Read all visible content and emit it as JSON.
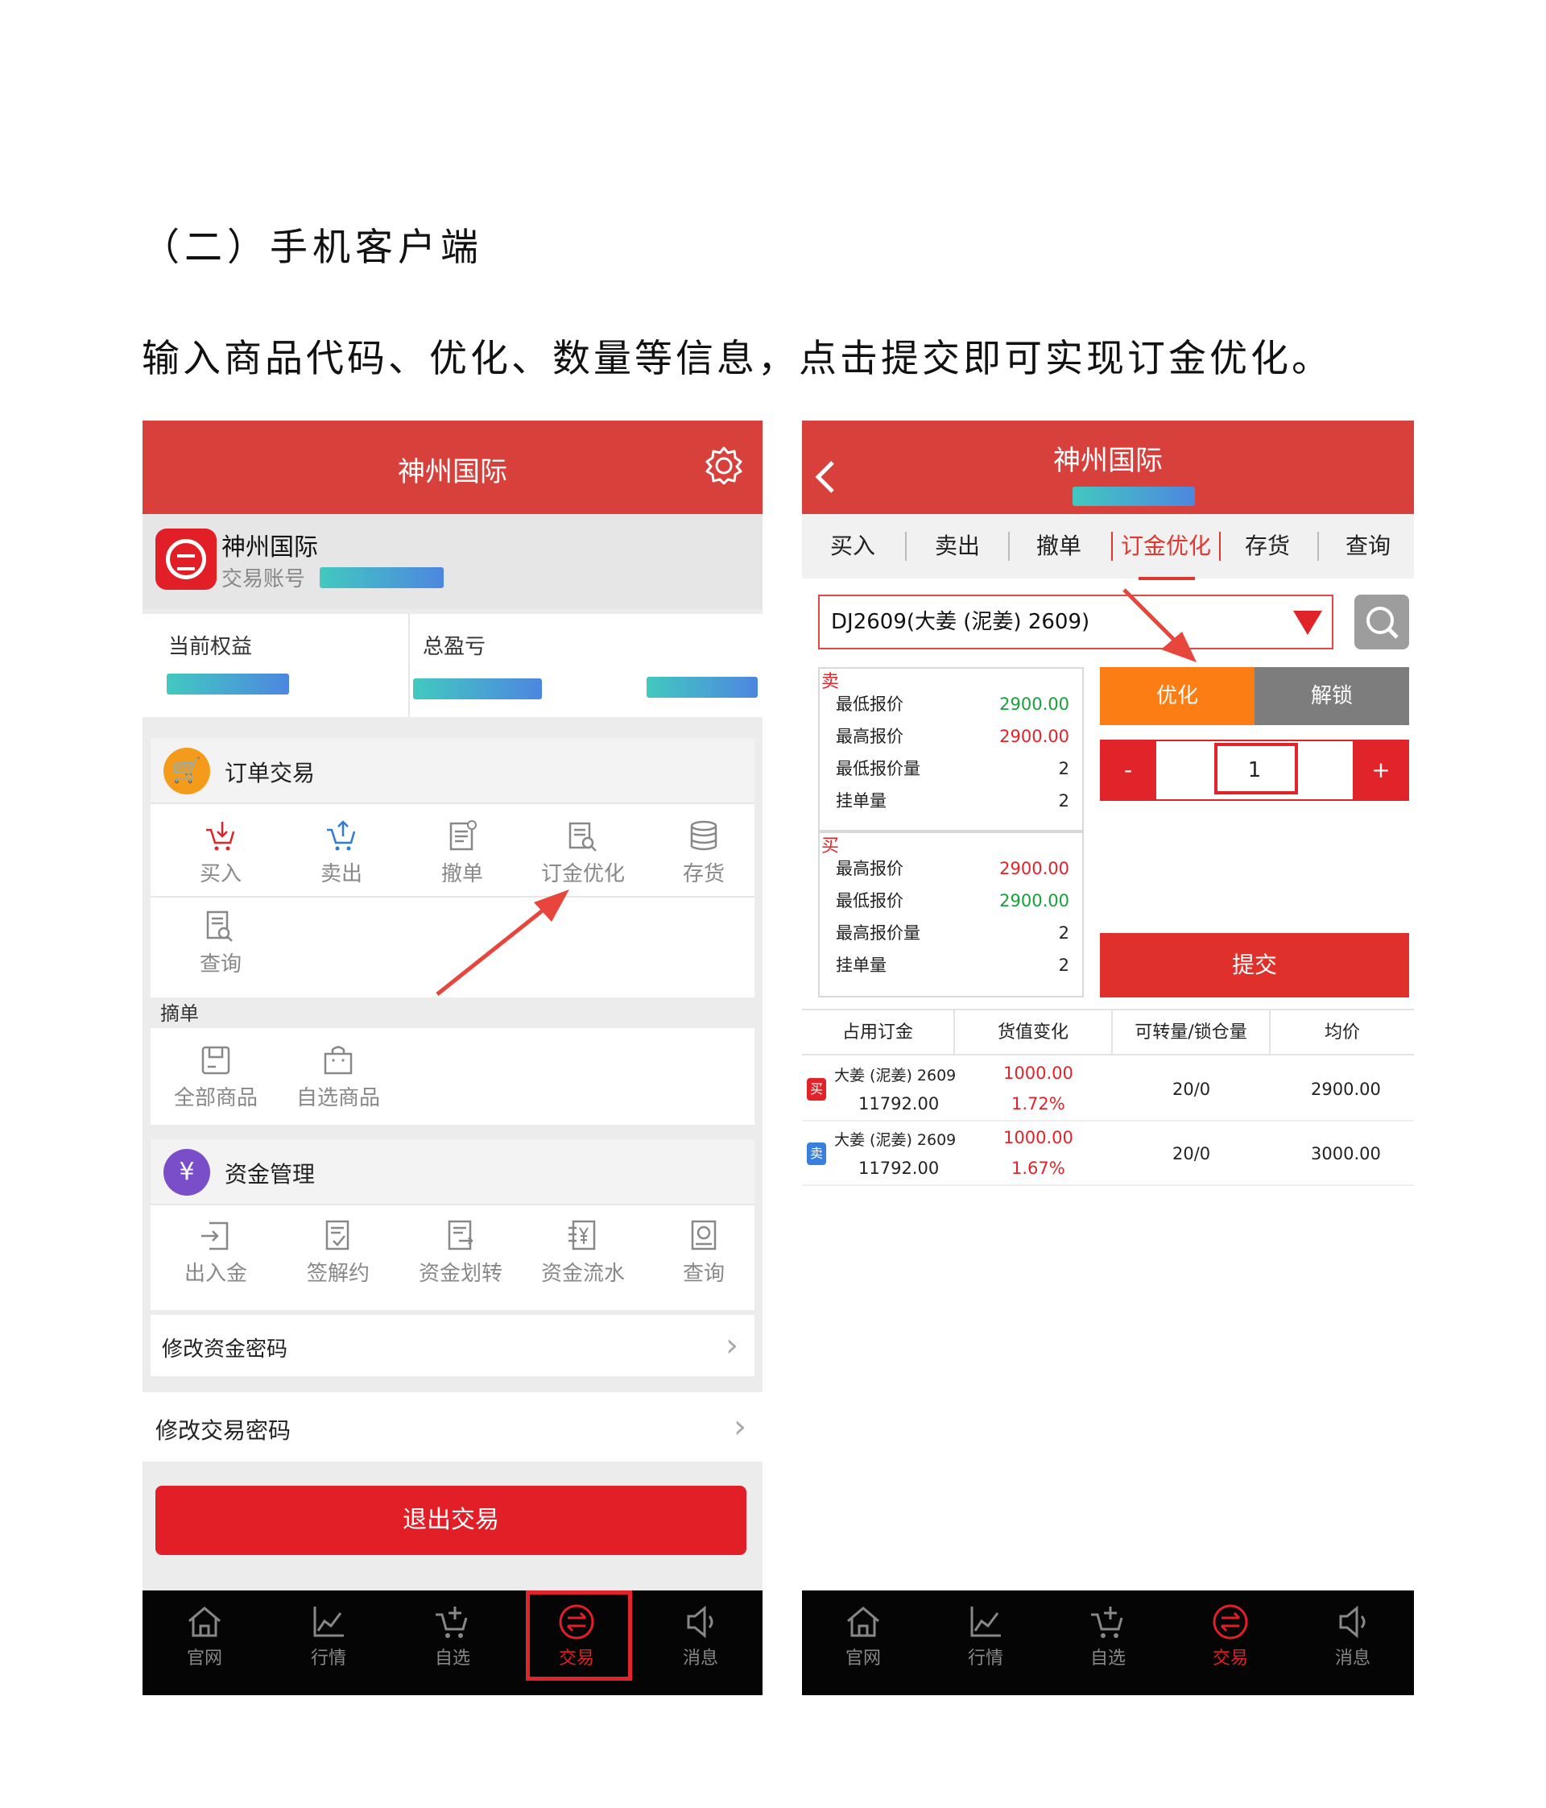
{
  "doc": {
    "section_heading": "（二）手机客户端",
    "intro": "输入商品代码、优化、数量等信息，点击提交即可实现订金优化。"
  },
  "left": {
    "header_title": "神州国际",
    "account_name": "神州国际",
    "account_label": "交易账号",
    "equity_label": "当前权益",
    "pnl_label": "总盈亏",
    "order_section": "订单交易",
    "order_items": [
      "买入",
      "卖出",
      "撤单",
      "订金优化",
      "存货",
      "查询"
    ],
    "pick_label": "摘单",
    "pick_items": [
      "全部商品",
      "自选商品"
    ],
    "fund_section": "资金管理",
    "fund_badge": "¥",
    "fund_items": [
      "出入金",
      "签解约",
      "资金划转",
      "资金流水",
      "查询"
    ],
    "change_fund_pwd": "修改资金密码",
    "change_trade_pwd": "修改交易密码",
    "logout": "退出交易"
  },
  "tabbar": {
    "items": [
      "官网",
      "行情",
      "自选",
      "交易",
      "消息"
    ],
    "active_index": 3
  },
  "right": {
    "header_title": "神州国际",
    "tabs": [
      "买入",
      "卖出",
      "撤单",
      "订金优化",
      "存货",
      "查询"
    ],
    "active_tab": "订金优化",
    "product": "DJ2609(大姜 (泥姜) 2609)",
    "sell_side": "卖",
    "sell_rows": [
      {
        "label": "最低报价",
        "value": "2900.00",
        "color": "green"
      },
      {
        "label": "最高报价",
        "value": "2900.00",
        "color": "red"
      },
      {
        "label": "最低报价量",
        "value": "2",
        "color": "dark"
      },
      {
        "label": "挂单量",
        "value": "2",
        "color": "dark"
      }
    ],
    "buy_side": "买",
    "buy_rows": [
      {
        "label": "最高报价",
        "value": "2900.00",
        "color": "red"
      },
      {
        "label": "最低报价",
        "value": "2900.00",
        "color": "green"
      },
      {
        "label": "最高报价量",
        "value": "2",
        "color": "dark"
      },
      {
        "label": "挂单量",
        "value": "2",
        "color": "dark"
      }
    ],
    "btn_optimize": "优化",
    "btn_unlock": "解锁",
    "minus": "-",
    "plus": "+",
    "quantity": "1",
    "submit": "提交",
    "table_headers": [
      "占用订金",
      "货值变化",
      "可转量/锁仓量",
      "均价"
    ],
    "positions": [
      {
        "side": "买",
        "name": "大姜 (泥姜) 2609",
        "deposit": "11792.00",
        "value": "1000.00",
        "pct": "1.72%",
        "qty": "20/0",
        "avg": "2900.00",
        "badge_color": "#e0242a"
      },
      {
        "side": "卖",
        "name": "大姜 (泥姜) 2609",
        "deposit": "11792.00",
        "value": "1000.00",
        "pct": "1.67%",
        "qty": "20/0",
        "avg": "3000.00",
        "badge_color": "#3a7fe0"
      }
    ]
  },
  "colors": {
    "header_red": "#d8403b",
    "accent_red": "#e0242a",
    "optimize_orange": "#fb7d14",
    "unlock_gray": "#7d7d7d",
    "order_badge": "#f59b1b",
    "fund_badge": "#7a4ec9"
  }
}
